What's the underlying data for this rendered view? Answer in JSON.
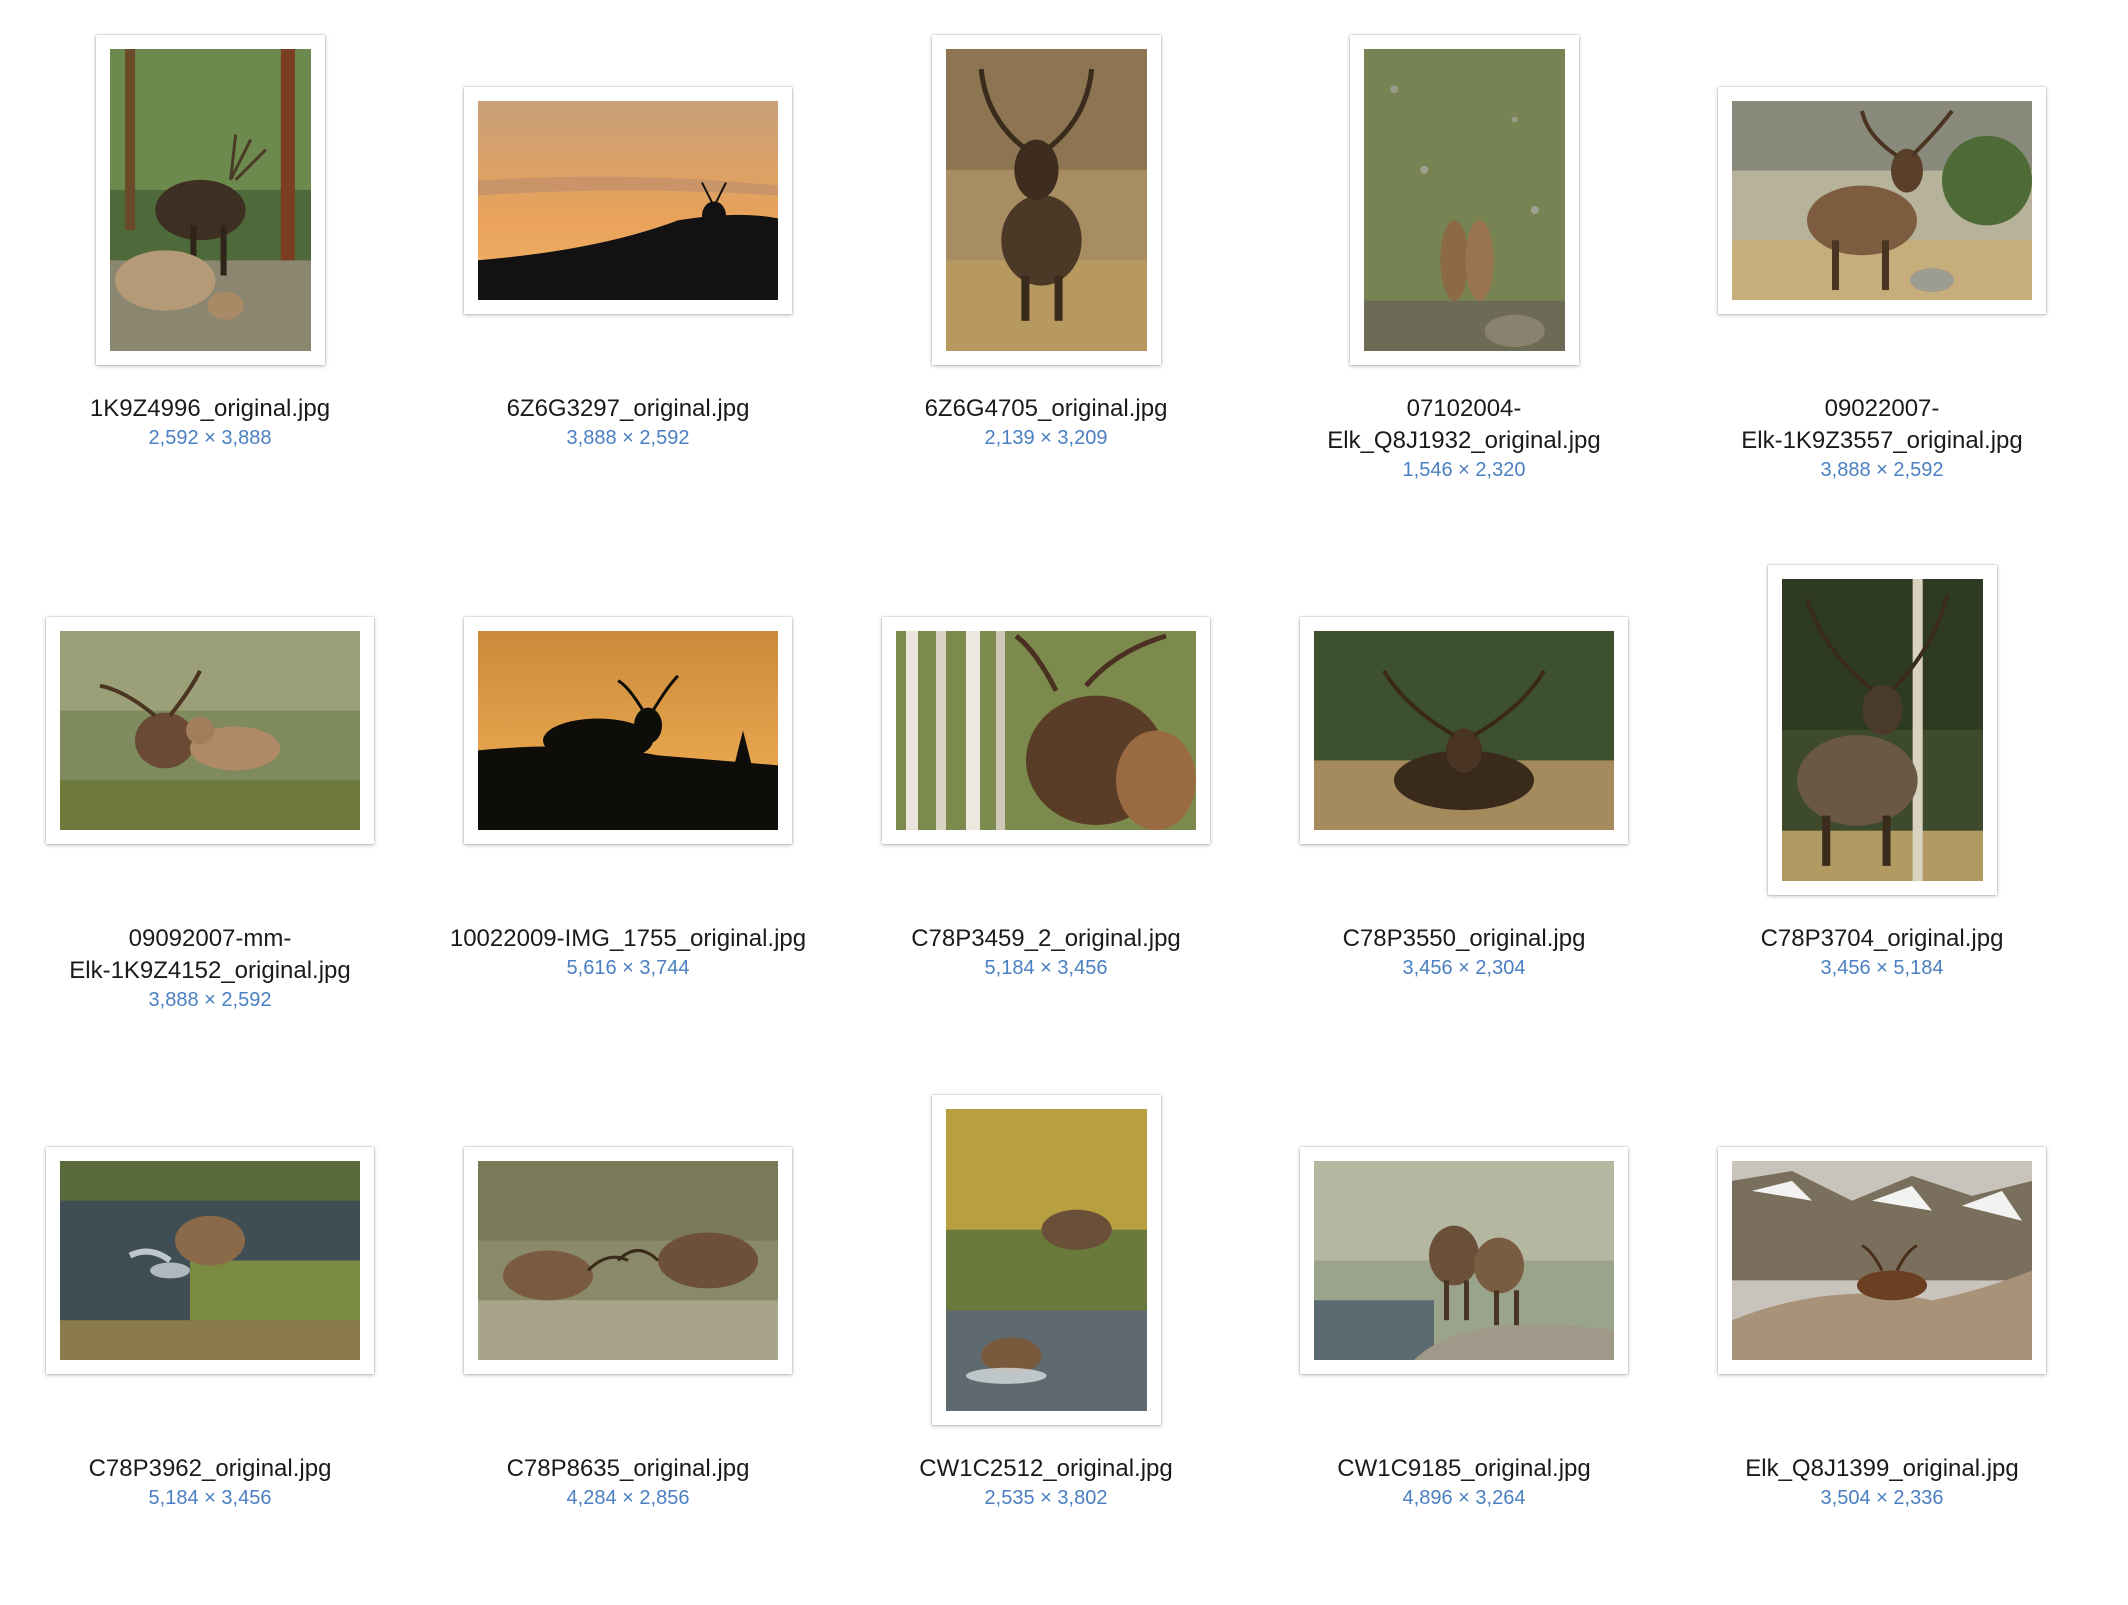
{
  "items": [
    {
      "filename": "1K9Z4996_original.jpg",
      "dimensions": "2,592 × 3,888",
      "orientation": "portrait",
      "scene": "forest-cow-bull"
    },
    {
      "filename": "6Z6G3297_original.jpg",
      "dimensions": "3,888 × 2,592",
      "orientation": "landscape",
      "scene": "sunset-silhouette"
    },
    {
      "filename": "6Z6G4705_original.jpg",
      "dimensions": "2,139 × 3,209",
      "orientation": "portrait",
      "scene": "bull-grass"
    },
    {
      "filename": "07102004-\nElk_Q8J1932_original.jpg",
      "dimensions": "1,546 × 2,320",
      "orientation": "portrait",
      "scene": "sparring-meadow"
    },
    {
      "filename": "09022007-\nElk-1K9Z3557_original.jpg",
      "dimensions": "3,888 × 2,592",
      "orientation": "landscape",
      "scene": "bull-bugling"
    },
    {
      "filename": "09092007-mm-\nElk-1K9Z4152_original.jpg",
      "dimensions": "3,888 × 2,592",
      "orientation": "landscape",
      "scene": "bull-cow-brush"
    },
    {
      "filename": "10022009-IMG_1755_original.jpg",
      "dimensions": "5,616 × 3,744",
      "orientation": "landscape",
      "scene": "dusk-silhouette"
    },
    {
      "filename": "C78P3459_2_original.jpg",
      "dimensions": "5,184 × 3,456",
      "orientation": "landscape",
      "scene": "aspen-bugle"
    },
    {
      "filename": "C78P3550_original.jpg",
      "dimensions": "3,456 × 2,304",
      "orientation": "landscape",
      "scene": "bull-forest-edge"
    },
    {
      "filename": "C78P3704_original.jpg",
      "dimensions": "3,456 × 5,184",
      "orientation": "portrait",
      "scene": "bull-aspen"
    },
    {
      "filename": "C78P3962_original.jpg",
      "dimensions": "5,184 × 3,456",
      "orientation": "landscape",
      "scene": "river-splash"
    },
    {
      "filename": "C78P8635_original.jpg",
      "dimensions": "4,284 × 2,856",
      "orientation": "landscape",
      "scene": "bulls-fighting"
    },
    {
      "filename": "CW1C2512_original.jpg",
      "dimensions": "2,535 × 3,802",
      "orientation": "portrait",
      "scene": "stream-autumn"
    },
    {
      "filename": "CW1C9185_original.jpg",
      "dimensions": "4,896 × 3,264",
      "orientation": "landscape",
      "scene": "calves-frost"
    },
    {
      "filename": "Elk_Q8J1399_original.jpg",
      "dimensions": "3,504 × 2,336",
      "orientation": "landscape",
      "scene": "alpine-snow"
    }
  ],
  "colors": {
    "dimension_text": "#4a7fc1",
    "filename_text": "#1a1a1a",
    "background": "#ffffff"
  }
}
